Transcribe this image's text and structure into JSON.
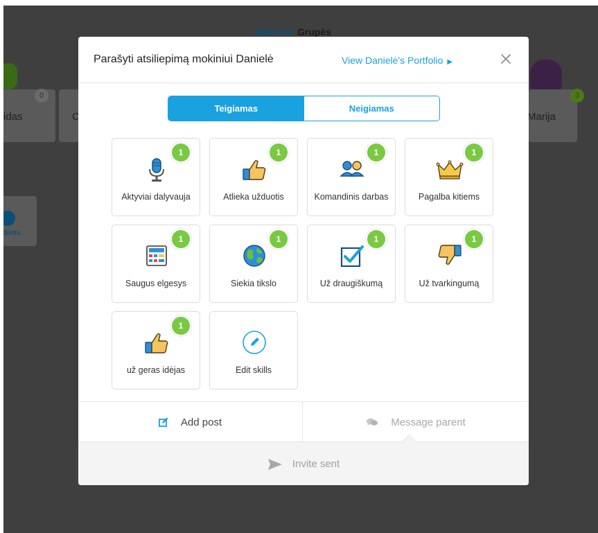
{
  "background": {
    "tabs": {
      "active": "Mokiniai",
      "other": "Grupės"
    },
    "students": [
      {
        "name": "idas",
        "badge": "0"
      },
      {
        "name": "C",
        "badge": ""
      },
      {
        "name": "Marija",
        "badge": "3"
      }
    ],
    "students_button_label": "dents"
  },
  "modal": {
    "title": "Parašyti atsiliepimą mokiniui Danielė",
    "portfolio_link": "View Danielė's Portfolio",
    "portfolio_link_arrow": "▶",
    "tabs": [
      {
        "label": "Teigiamas",
        "active": true
      },
      {
        "label": "Neigiamas",
        "active": false
      }
    ],
    "skills": [
      {
        "label": "Aktyviai dalyvauja",
        "count": "1",
        "icon": "microphone-icon"
      },
      {
        "label": "Atlieka užduotis",
        "count": "1",
        "icon": "thumbs-up-icon"
      },
      {
        "label": "Komandinis darbas",
        "count": "1",
        "icon": "teamwork-icon"
      },
      {
        "label": "Pagalba kitiems",
        "count": "1",
        "icon": "crown-icon"
      },
      {
        "label": "Saugus elgesys",
        "count": "1",
        "icon": "calculator-icon"
      },
      {
        "label": "Siekia tikslo",
        "count": "1",
        "icon": "globe-icon"
      },
      {
        "label": "Už draugiškumą",
        "count": "1",
        "icon": "checkbox-icon"
      },
      {
        "label": "Už tvarkingumą",
        "count": "1",
        "icon": "thumbs-down-icon"
      },
      {
        "label": "už geras idėjas",
        "count": "1",
        "icon": "thumbs-up-icon"
      },
      {
        "label": "Edit skills",
        "count": "",
        "icon": "pencil-circle-icon"
      }
    ],
    "footer": {
      "add_post": "Add post",
      "message_parent": "Message parent",
      "invite_status": "Invite sent"
    }
  },
  "colors": {
    "accent": "#1aa1df",
    "badge": "#7ac943",
    "overlay": "#3f3f3f"
  }
}
